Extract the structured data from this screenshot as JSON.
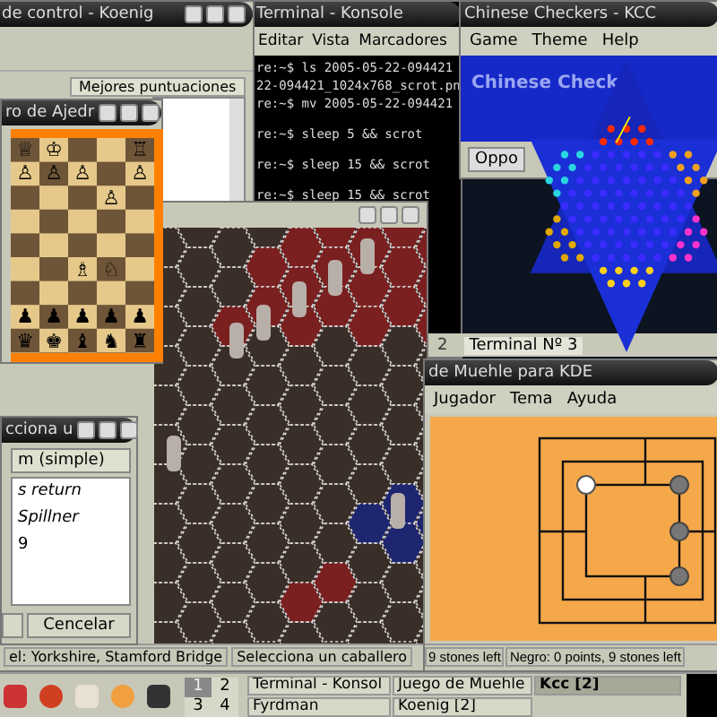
{
  "koenig": {
    "title": "de control - Koenig",
    "tabs": [
      {
        "label": "Mejores puntuaciones",
        "selected": true
      }
    ]
  },
  "konsole": {
    "title": "Terminal - Konsole",
    "menu": [
      "Editar",
      "Vista",
      "Marcadores"
    ],
    "lines": [
      {
        "text": "re:~$ ls 2005-05-22-094421",
        "blank_line_before": false
      },
      {
        "text": "22-094421_1024x768_scrot.pn",
        "blank_line_before": false
      },
      {
        "text": "re:~$ mv 2005-05-22-094421",
        "blank_line_before": false
      },
      {
        "text": "re:~$ sleep 5 && scrot",
        "blank_line_before": true
      },
      {
        "text": "re:~$ sleep 15 && scrot",
        "blank_line_before": true
      },
      {
        "text": "re:~$ sleep 15 && scrot",
        "blank_line_before": true
      }
    ],
    "tabs": [
      {
        "label": "2",
        "selected": false
      },
      {
        "label": "Terminal Nº 3",
        "selected": true
      }
    ]
  },
  "kcc": {
    "title": "Chinese Checkers - KCC",
    "menu": [
      "Game",
      "Theme",
      "Help"
    ],
    "banner": "Chinese Check",
    "button": "Oppo"
  },
  "chess": {
    "title": "ro de Ajedr",
    "rows": [
      [
        "♕",
        "♔",
        null,
        null,
        "♖"
      ],
      [
        "♙",
        "♙",
        "♙",
        null,
        "♙"
      ],
      [
        null,
        null,
        null,
        "♙",
        null
      ],
      [
        null,
        null,
        null,
        null,
        null
      ],
      [
        null,
        null,
        null,
        null,
        null
      ],
      [
        null,
        null,
        "♗",
        "♘",
        null
      ],
      [
        null,
        null,
        null,
        null,
        null
      ],
      [
        "♟",
        "♟",
        "♟",
        "♟",
        "♟"
      ],
      [
        "♛",
        "♚",
        "♝",
        "♞",
        "♜"
      ]
    ]
  },
  "battle": {
    "status": [
      "el: Yorkshire, Stamford Bridge",
      "Selecciona un caballero"
    ]
  },
  "dialog": {
    "title": "cciona u",
    "dropdown": "m (simple)",
    "lines": [
      {
        "text": "s return",
        "italic": true
      },
      {
        "text": "Spillner",
        "italic": true
      },
      {
        "text": "9",
        "italic": false
      }
    ],
    "button": "Cencelar"
  },
  "muehle": {
    "title": "de Muehle para KDE",
    "menu": [
      "Jugador",
      "Tema",
      "Ayuda"
    ],
    "status": [
      "9 stones left",
      "Negro: 0 points, 9 stones left"
    ]
  },
  "taskbar": {
    "desktops": [
      {
        "label": "1",
        "selected": true
      },
      {
        "label": "2",
        "selected": false
      },
      {
        "label": "3",
        "selected": false
      },
      {
        "label": "4",
        "selected": false
      }
    ],
    "tasks": [
      {
        "label": "Terminal - Konsol",
        "selected": false
      },
      {
        "label": "Juego de Muehle",
        "selected": false
      },
      {
        "label": "Kcc [2]",
        "selected": true
      },
      {
        "label": "Fyrdman",
        "selected": false
      },
      {
        "label": "Koenig [2]",
        "selected": false
      }
    ]
  }
}
